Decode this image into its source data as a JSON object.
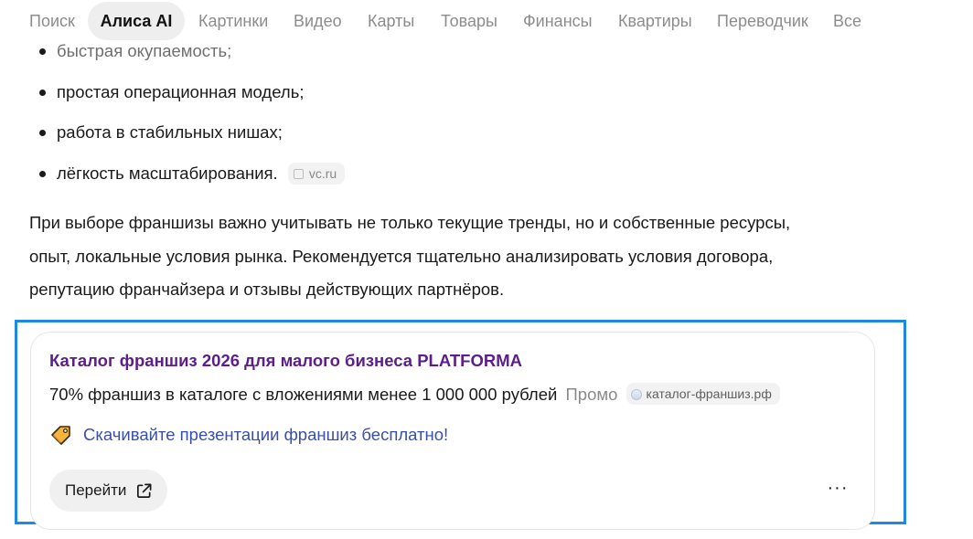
{
  "nav": {
    "tabs": [
      {
        "label": "Поиск"
      },
      {
        "label": "Алиса AI",
        "active": true
      },
      {
        "label": "Картинки"
      },
      {
        "label": "Видео"
      },
      {
        "label": "Карты"
      },
      {
        "label": "Товары"
      },
      {
        "label": "Финансы"
      },
      {
        "label": "Квартиры"
      },
      {
        "label": "Переводчик"
      },
      {
        "label": "Все"
      }
    ]
  },
  "answer": {
    "bullets": [
      {
        "text": "быстрая окупаемость;"
      },
      {
        "text": "простая операционная модель;"
      },
      {
        "text": "работа в стабильных нишах;"
      },
      {
        "text": "лёгкость масштабирования."
      }
    ],
    "source_chip": {
      "label": "vc.ru",
      "icon": "source-icon"
    },
    "paragraph_lines": [
      "При выборе франшизы важно учитывать не только текущие тренды, но и собственные ресурсы,",
      "опыт, локальные условия рынка. Рекомендуется тщательно анализировать условия договора,",
      "репутацию франчайзера и отзывы действующих партнёров."
    ]
  },
  "ad": {
    "title": "Каталог франшиз 2026 для малого бизнеса PLATFORMA",
    "description": "70% франшиз в каталоге с вложениями менее 1 000 000 рублей",
    "promo_label": "Промо",
    "domain": "каталог-франшиз.рф",
    "sitelink": "Скачивайте презентации франшиз бесплатно!",
    "go_button": "Перейти",
    "more_label": "···",
    "colors": {
      "title": "#5b1e8c",
      "sitelink": "#3a4fa8",
      "highlight_frame": "#1e88e5"
    }
  }
}
